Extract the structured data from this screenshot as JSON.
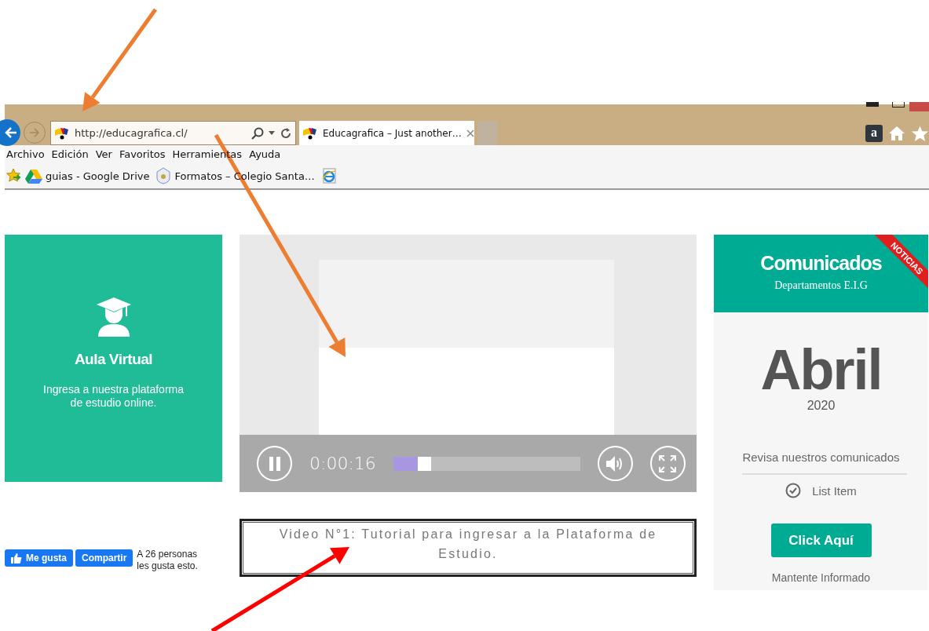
{
  "annotation_arrows": [
    {
      "color": "#ed7d31"
    },
    {
      "color": "#ed7d31"
    },
    {
      "color": "#ff0000"
    }
  ],
  "browser": {
    "amazon_button": "a",
    "forward_button": {
      "disabled": true
    },
    "address": "http://educagrafica.cl/",
    "tabs": [
      {
        "title": "Educagrafica – Just another…",
        "selected": true
      }
    ],
    "menu": [
      "Archivo",
      "Edición",
      "Ver",
      "Favoritos",
      "Herramientas",
      "Ayuda"
    ],
    "favorites": [
      {
        "kind": "drive",
        "label": "guias - Google Drive"
      },
      {
        "kind": "school",
        "label": "Formatos – Colegio Santa…"
      },
      {
        "kind": "ie"
      }
    ]
  },
  "aula_virtual": {
    "title": "Aula Virtual",
    "description": "Ingresa a nuestra plataforma de estudio online."
  },
  "facebook": {
    "like_label": "Me gusta",
    "share_label": "Compartir",
    "count_text": "A 26 personas les gusta esto."
  },
  "video": {
    "playing": true,
    "time": "0:00:16",
    "level": 0.13
  },
  "caption": "Video N°1: Tutorial para ingresar a la Plataforma de Estudio.",
  "news": {
    "ribbon": "NOTICIAS",
    "title": "Comunicados",
    "subtitle": "Departamentos E.I.G",
    "month": "Abril",
    "year": "2020",
    "intro": "Revisa nuestros comunicados",
    "list_items": [
      {
        "label": "List Item",
        "checked": true
      }
    ],
    "button": "Click Aquí",
    "footer": "Mantente Informado"
  }
}
